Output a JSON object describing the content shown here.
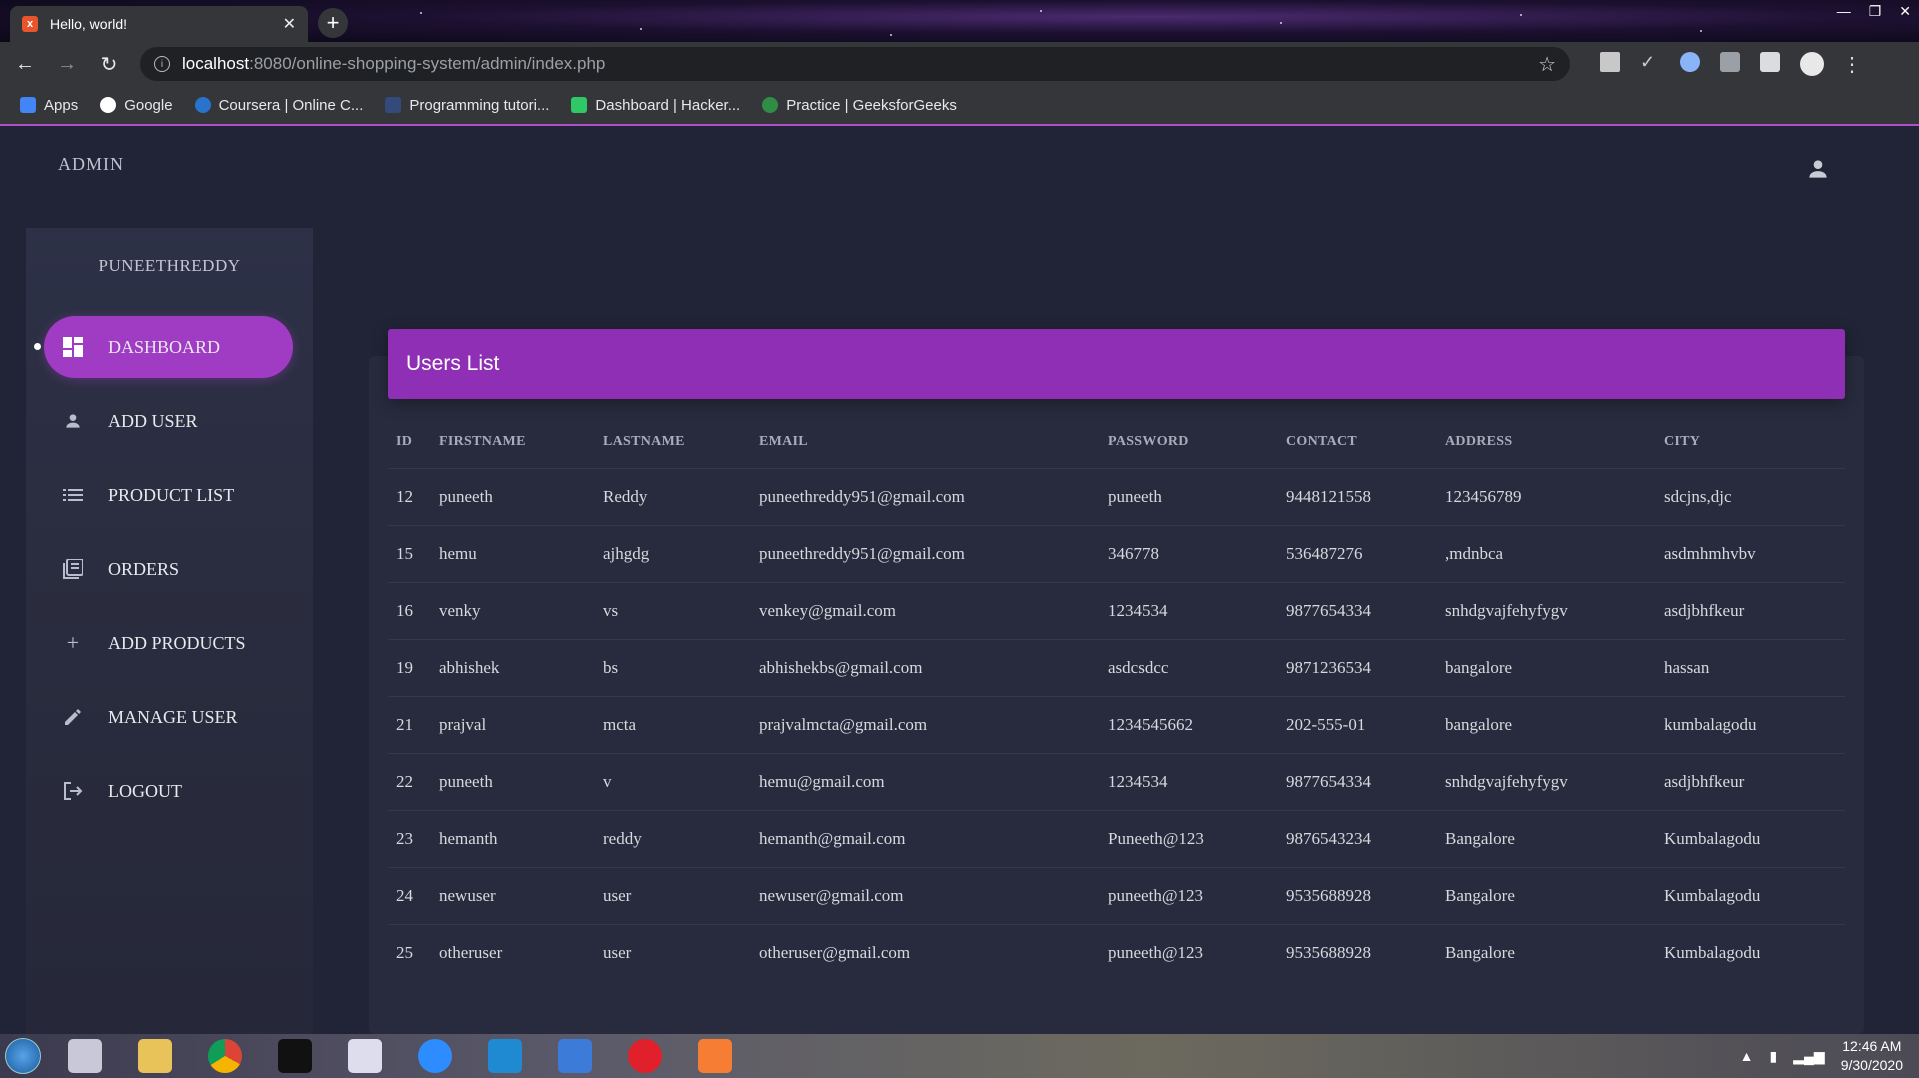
{
  "browser": {
    "tab_title": "Hello, world!",
    "url_host": "localhost",
    "url_path": ":8080/online-shopping-system/admin/index.php",
    "bookmarks": [
      {
        "label": "Apps",
        "color": "#4285f4"
      },
      {
        "label": "Google",
        "color": "#ffffff"
      },
      {
        "label": "Coursera | Online C...",
        "color": "#2a73cc"
      },
      {
        "label": "Programming tutori...",
        "color": "#334a7a"
      },
      {
        "label": "Dashboard | Hacker...",
        "color": "#2ec866"
      },
      {
        "label": "Practice | GeeksforGeeks",
        "color": "#2f8d46"
      }
    ]
  },
  "header": {
    "brand": "ADMIN"
  },
  "sidebar": {
    "username": "PUNEETHREDDY",
    "items": [
      {
        "label": "DASHBOARD",
        "icon": "dashboard-icon",
        "active": true
      },
      {
        "label": "ADD USER",
        "icon": "person-icon"
      },
      {
        "label": "PRODUCT LIST",
        "icon": "list-icon"
      },
      {
        "label": "ORDERS",
        "icon": "library-icon"
      },
      {
        "label": "ADD PRODUCTS",
        "icon": "plus-icon"
      },
      {
        "label": "MANAGE USER",
        "icon": "pencil-icon"
      },
      {
        "label": "LOGOUT",
        "icon": "logout-icon"
      }
    ]
  },
  "main": {
    "card_title": "Users List",
    "columns": [
      "ID",
      "FIRSTNAME",
      "LASTNAME",
      "EMAIL",
      "PASSWORD",
      "CONTACT",
      "ADDRESS",
      "CITY"
    ],
    "rows": [
      [
        "12",
        "puneeth",
        "Reddy",
        "puneethreddy951@gmail.com",
        "puneeth",
        "9448121558",
        "123456789",
        "sdcjns,djc"
      ],
      [
        "15",
        "hemu",
        "ajhgdg",
        "puneethreddy951@gmail.com",
        "346778",
        "536487276",
        ",mdnbca",
        "asdmhmhvbv"
      ],
      [
        "16",
        "venky",
        "vs",
        "venkey@gmail.com",
        "1234534",
        "9877654334",
        "snhdgvajfehyfygv",
        "asdjbhfkeur"
      ],
      [
        "19",
        "abhishek",
        "bs",
        "abhishekbs@gmail.com",
        "asdcsdcc",
        "9871236534",
        "bangalore",
        "hassan"
      ],
      [
        "21",
        "prajval",
        "mcta",
        "prajvalmcta@gmail.com",
        "1234545662",
        "202-555-01",
        "bangalore",
        "kumbalagodu"
      ],
      [
        "22",
        "puneeth",
        "v",
        "hemu@gmail.com",
        "1234534",
        "9877654334",
        "snhdgvajfehyfygv",
        "asdjbhfkeur"
      ],
      [
        "23",
        "hemanth",
        "reddy",
        "hemanth@gmail.com",
        "Puneeth@123",
        "9876543234",
        "Bangalore",
        "Kumbalagodu"
      ],
      [
        "24",
        "newuser",
        "user",
        "newuser@gmail.com",
        "puneeth@123",
        "9535688928",
        "Bangalore",
        "Kumbalagodu"
      ],
      [
        "25",
        "otheruser",
        "user",
        "otheruser@gmail.com",
        "puneeth@123",
        "9535688928",
        "Bangalore",
        "Kumbalagodu"
      ]
    ]
  },
  "taskbar": {
    "time": "12:46 AM",
    "date": "9/30/2020"
  },
  "colors": {
    "accent": "#8e2fb5",
    "active_nav": "#a03cc4",
    "background": "#202436"
  }
}
